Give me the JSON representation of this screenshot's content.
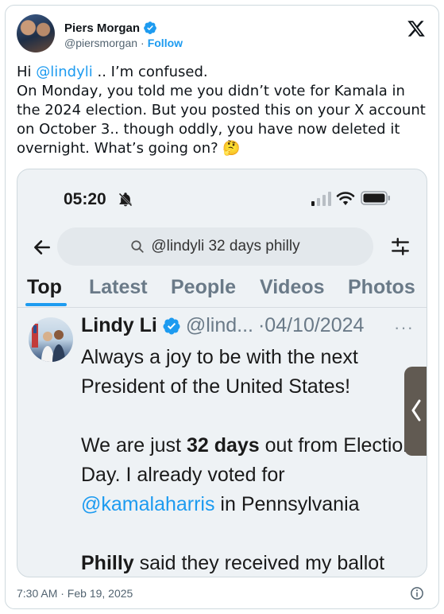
{
  "author": {
    "name": "Piers Morgan",
    "handle": "@piersmorgan",
    "separator": "·",
    "follow_label": "Follow"
  },
  "tweet": {
    "greeting": "Hi ",
    "mention": "@lindyli",
    "line1_rest": " .. I’m confused.",
    "body": "On Monday, you told me you didn’t vote for Kamala in the 2024 election. But you posted this on your X account on October 3.. though oddly, you have now deleted it overnight. What’s going on? 🤔"
  },
  "screenshot": {
    "status_time": "05:20",
    "search_query": "@lindyli 32 days philly",
    "tabs": [
      {
        "label": "Top",
        "active": true
      },
      {
        "label": "Latest",
        "active": false
      },
      {
        "label": "People",
        "active": false
      },
      {
        "label": "Videos",
        "active": false
      },
      {
        "label": "Photos",
        "active": false
      }
    ],
    "post": {
      "name": "Lindy Li",
      "handle_trunc": "@lind...",
      "date": "·04/10/2024",
      "more": "···",
      "line1": "Always a joy to be with the next President of the United States!",
      "p2_a": "We are just ",
      "p2_b": "32 days",
      "p2_c": " out from Election Day. I already voted for ",
      "p2_mention": "@kamalaharris",
      "p2_d": " in Pennsylvania",
      "p3_a": "Philly",
      "p3_b": " said they received my ballot"
    }
  },
  "footer": {
    "timestamp": "7:30 AM · Feb 19, 2025"
  },
  "colors": {
    "accent": "#1d9bf0",
    "text": "#0f1419",
    "muted": "#536471",
    "border": "#cfd9de"
  },
  "icons": [
    "verified-badge-icon",
    "x-logo-icon",
    "bell-muted-icon",
    "signal-icon",
    "wifi-icon",
    "battery-icon",
    "back-arrow-icon",
    "search-icon",
    "filter-icon",
    "more-icon",
    "chevron-left-icon",
    "info-icon"
  ]
}
